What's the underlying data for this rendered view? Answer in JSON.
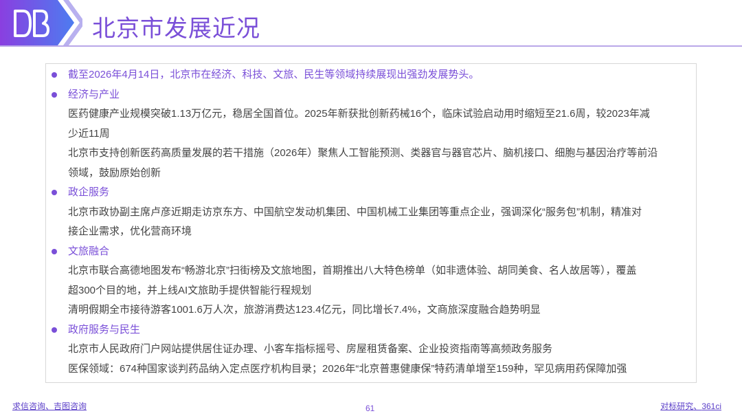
{
  "header": {
    "title": "北京市发展近况",
    "logo_icon": "brand-logo-icon"
  },
  "content": {
    "intro": "截至2026年4月14日，北京市在经济、科技、文旅、民生等领域持续展现出强劲发展势头。",
    "sections": [
      {
        "heading": "经济与产业",
        "lines": [
          "医药健康产业规模突破1.13万亿元，稳居全国首位。2025年新获批创新药械16个，临床试验启动用时缩短至21.6周，较2023年减",
          "少近11周",
          "北京市支持创新医药高质量发展的若干措施（2026年）聚焦人工智能预测、类器官与器官芯片、脑机接口、细胞与基因治疗等前沿",
          "领域，鼓励原始创新"
        ]
      },
      {
        "heading": "政企服务",
        "lines": [
          "北京市政协副主席卢彦近期走访京东方、中国航空发动机集团、中国机械工业集团等重点企业，强调深化“服务包”机制，精准对",
          "接企业需求，优化营商环境"
        ]
      },
      {
        "heading": "文旅融合",
        "lines": [
          "北京市联合高德地图发布“畅游北京”扫街榜及文旅地图，首期推出八大特色榜单（如非遗体验、胡同美食、名人故居等），覆盖",
          "超300个目的地，并上线AI文旅助手提供智能行程规划",
          "清明假期全市接待游客1001.6万人次，旅游消费达123.4亿元，同比增长7.4%，文商旅深度融合趋势明显"
        ]
      },
      {
        "heading": "政府服务与民生",
        "lines": [
          "北京市人民政府门户网站提供居住证办理、小客车指标摇号、房屋租赁备案、企业投资指南等高频政务服务",
          "医保领域：674种国家谈判药品纳入定点医疗机构目录；2026年“北京普惠健康保”特药清单增至159种，罕见病用药保障加强"
        ]
      }
    ]
  },
  "footer": {
    "left_link_1": "求信咨询",
    "left_sep": "、",
    "left_link_2": "吉图咨询",
    "page_number": "61",
    "right_link_1": "对标研究",
    "right_sep": "、",
    "right_link_2": "361ci"
  },
  "colors": {
    "accent": "#7a4fd8",
    "body_text": "#444444",
    "link": "#5a3ec8"
  }
}
